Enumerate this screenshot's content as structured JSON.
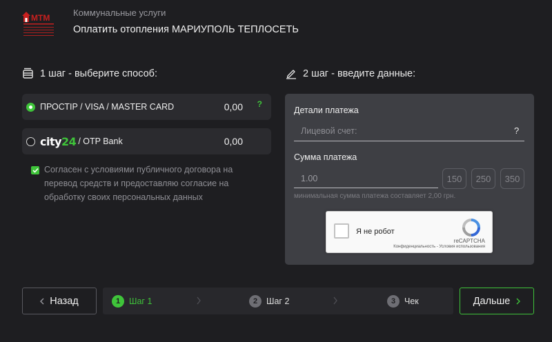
{
  "header": {
    "logo_text": "МТМ",
    "subtitle": "Коммунальные услуги",
    "title": "Оплатить отопления МАРИУПОЛЬ ТЕПЛОСЕТЬ"
  },
  "step1": {
    "title": "1 шаг - выберите способ:",
    "methods": [
      {
        "label": "ПРОСТIP / VISA / MASTER CARD",
        "amount": "0,00",
        "help": "?",
        "selected": true
      },
      {
        "logo_main": "city",
        "logo_accent": "24",
        "label": "/ OTP Bank",
        "amount": "0,00",
        "selected": false
      }
    ],
    "agreement": "Согласен с условиями публичного договора на перевод средств и предоставляю согласие на обработку своих персональных данных"
  },
  "step2": {
    "title": "2 шаг - введите данные:",
    "details_label": "Детали платежа",
    "account_placeholder": "Лицевой счет:",
    "account_help": "?",
    "sum_label": "Сумма платежа",
    "sum_value": "1.00",
    "quick_amounts": [
      "150",
      "250",
      "350"
    ],
    "min_note": "минимальная сумма платежа составляет 2,00 грн.",
    "captcha": {
      "text": "Я не робот",
      "brand": "reCAPTCHA",
      "terms": "Конфиденциальность - Условия использования"
    }
  },
  "footer": {
    "back_label": "Назад",
    "next_label": "Дальше",
    "steps": [
      {
        "num": "1",
        "label": "Шаг 1",
        "active": true
      },
      {
        "num": "2",
        "label": "Шаг 2",
        "active": false
      },
      {
        "num": "3",
        "label": "Чек",
        "active": false
      }
    ]
  },
  "colors": {
    "background": "#1e1e21",
    "accent_green": "#3fc43a",
    "card": "#2b2b2f",
    "panel": "#3e3f44",
    "logo_red": "#c8201f"
  },
  "icons": {
    "step1": "wallet-icon",
    "step2": "pencil-icon",
    "back": "chevron-left-icon",
    "next": "chevron-right-icon",
    "step_separator": "chevron-right-icon"
  }
}
